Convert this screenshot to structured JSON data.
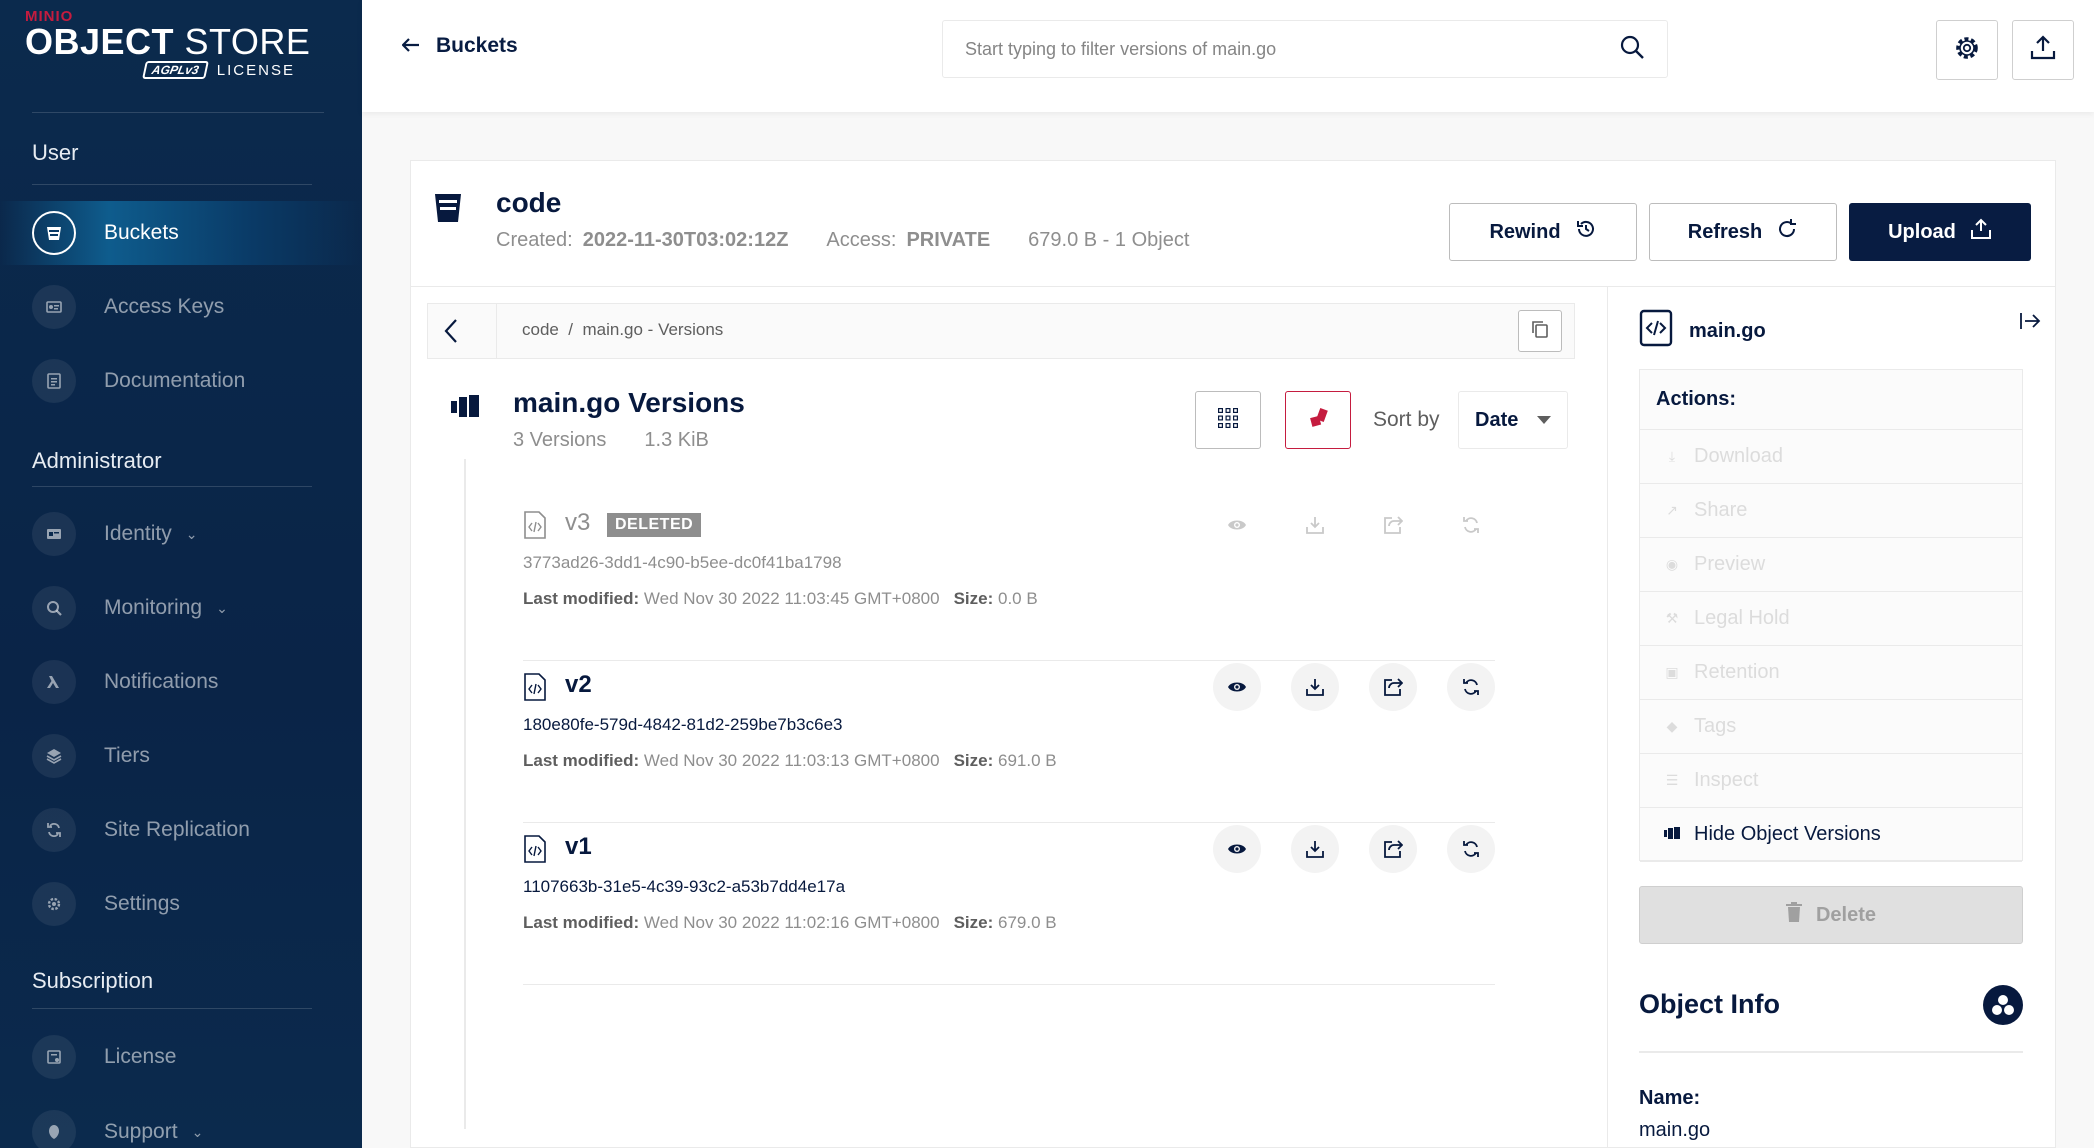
{
  "brand": {
    "minio": "MINIO",
    "product_bold": "OBJECT",
    "product_light": "STORE",
    "agpl": "AGPLv3",
    "license": "LICENSE"
  },
  "sidebar": {
    "sections": [
      {
        "title": "User"
      },
      {
        "title": "Administrator"
      },
      {
        "title": "Subscription"
      }
    ],
    "items": [
      {
        "label": "Buckets",
        "icon": "bucket-icon",
        "active": true
      },
      {
        "label": "Access Keys",
        "icon": "key-icon"
      },
      {
        "label": "Documentation",
        "icon": "document-icon"
      },
      {
        "label": "Identity",
        "icon": "identity-icon",
        "chevron": "⌄"
      },
      {
        "label": "Monitoring",
        "icon": "monitoring-icon",
        "chevron": "⌄"
      },
      {
        "label": "Notifications",
        "icon": "lambda-icon"
      },
      {
        "label": "Tiers",
        "icon": "tiers-icon"
      },
      {
        "label": "Site Replication",
        "icon": "replication-icon"
      },
      {
        "label": "Settings",
        "icon": "gear-icon"
      },
      {
        "label": "License",
        "icon": "license-icon"
      },
      {
        "label": "Support",
        "icon": "support-icon",
        "chevron": "⌄"
      }
    ]
  },
  "topbar": {
    "back_label": "Buckets",
    "search_placeholder": "Start typing to filter versions of main.go"
  },
  "bucket": {
    "name": "code",
    "created_label": "Created:",
    "created_value": "2022-11-30T03:02:12Z",
    "access_label": "Access:",
    "access_value": "PRIVATE",
    "usage": "679.0 B - 1 Object",
    "rewind_label": "Rewind",
    "refresh_label": "Refresh",
    "upload_label": "Upload"
  },
  "breadcrumb": {
    "text": "code  /  main.go - Versions"
  },
  "versions": {
    "title": "main.go Versions",
    "count": "3 Versions",
    "size": "1.3 KiB",
    "sort_label": "Sort by",
    "sort_value": "Date",
    "last_modified_label": "Last modified:",
    "size_label": "Size:",
    "deleted_badge": "DELETED",
    "rows": [
      {
        "version": "v3",
        "deleted": true,
        "id": "3773ad26-3dd1-4c90-b5ee-dc0f41ba1798",
        "modified": "Wed Nov 30 2022 11:03:45 GMT+0800",
        "size": "0.0 B"
      },
      {
        "version": "v2",
        "deleted": false,
        "id": "180e80fe-579d-4842-81d2-259be7b3c6e3",
        "modified": "Wed Nov 30 2022 11:03:13 GMT+0800",
        "size": "691.0 B"
      },
      {
        "version": "v1",
        "deleted": false,
        "id": "1107663b-31e5-4c39-93c2-a53b7dd4e17a",
        "modified": "Wed Nov 30 2022 11:02:16 GMT+0800",
        "size": "679.0 B"
      }
    ]
  },
  "details": {
    "file_name": "main.go",
    "actions_title": "Actions:",
    "actions": [
      {
        "label": "Download",
        "icon": "download-icon",
        "enabled": false
      },
      {
        "label": "Share",
        "icon": "share-icon",
        "enabled": false
      },
      {
        "label": "Preview",
        "icon": "eye-icon",
        "enabled": false
      },
      {
        "label": "Legal Hold",
        "icon": "gavel-icon",
        "enabled": false
      },
      {
        "label": "Retention",
        "icon": "retention-icon",
        "enabled": false
      },
      {
        "label": "Tags",
        "icon": "tag-icon",
        "enabled": false
      },
      {
        "label": "Inspect",
        "icon": "inspect-icon",
        "enabled": false
      },
      {
        "label": "Hide Object Versions",
        "icon": "versions-icon",
        "enabled": true
      }
    ],
    "delete_label": "Delete",
    "info_title": "Object Info",
    "name_label": "Name:",
    "name_value": "main.go"
  },
  "colors": {
    "navy": "#081c42",
    "accent_red": "#c51c3f",
    "muted": "#8e8e8e"
  }
}
